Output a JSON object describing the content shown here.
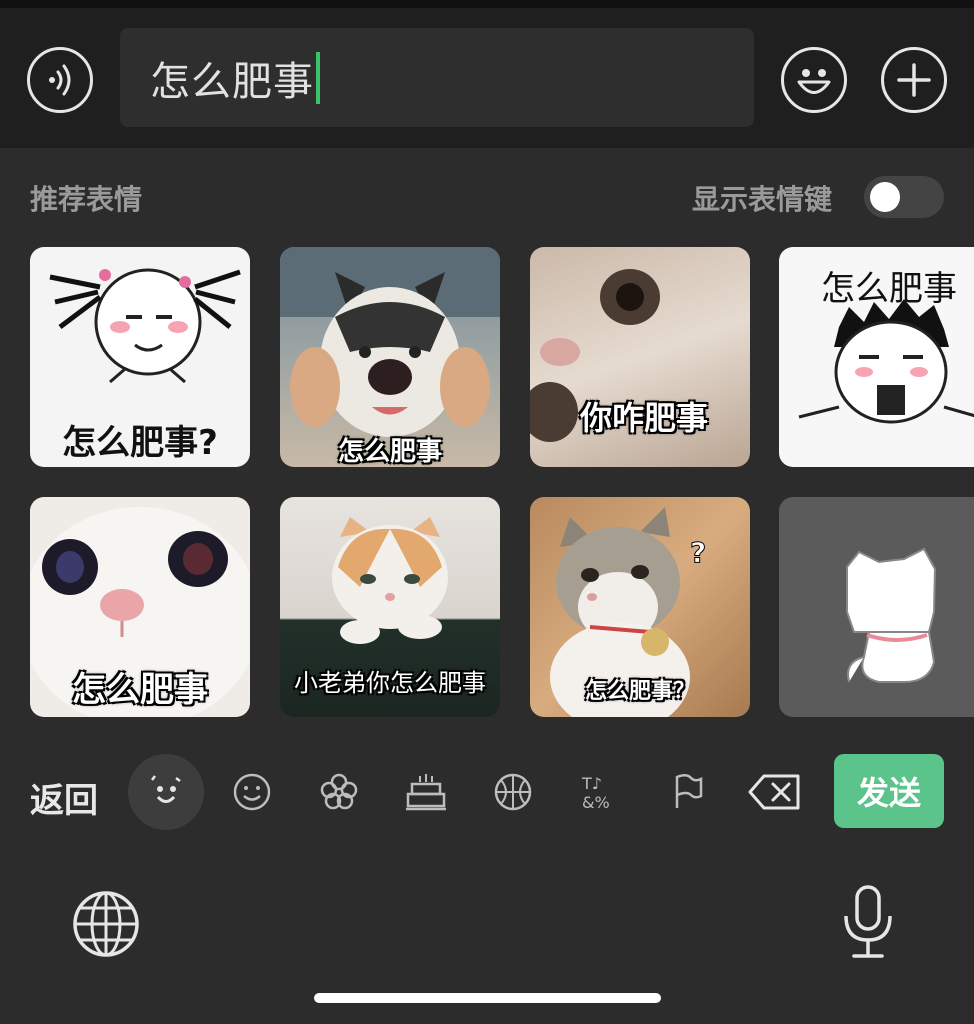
{
  "input": {
    "text": "怎么肥事"
  },
  "panel": {
    "recommend_title": "推荐表情",
    "toggle_label": "显示表情键",
    "toggle_on": false
  },
  "stickers": [
    {
      "caption": "怎么肥事?",
      "desc": "cartoon-face-pigtails"
    },
    {
      "caption": "怎么肥事",
      "desc": "husky-dog"
    },
    {
      "caption": "你咋肥事",
      "desc": "cat-closeup"
    },
    {
      "caption": "怎么肥事",
      "desc": "cartoon-face-messy-hair"
    },
    {
      "caption": "怎么肥事",
      "desc": "white-cat"
    },
    {
      "caption": "小老弟你怎么肥事",
      "desc": "orange-white-cat"
    },
    {
      "caption": "怎么肥事？",
      "desc": "tabby-cat-bell"
    },
    {
      "caption": "",
      "desc": "white-cartoon-cat"
    }
  ],
  "toolbar": {
    "back_label": "返回",
    "send_label": "发送",
    "icons": [
      "sticker-face-icon",
      "smiley-icon",
      "flower-icon",
      "cake-icon",
      "basketball-icon",
      "symbols-icon",
      "flag-icon",
      "backspace-icon"
    ]
  },
  "colors": {
    "accent": "#5ac48a",
    "caret": "#3cc36a",
    "background": "#2c2c2c"
  }
}
